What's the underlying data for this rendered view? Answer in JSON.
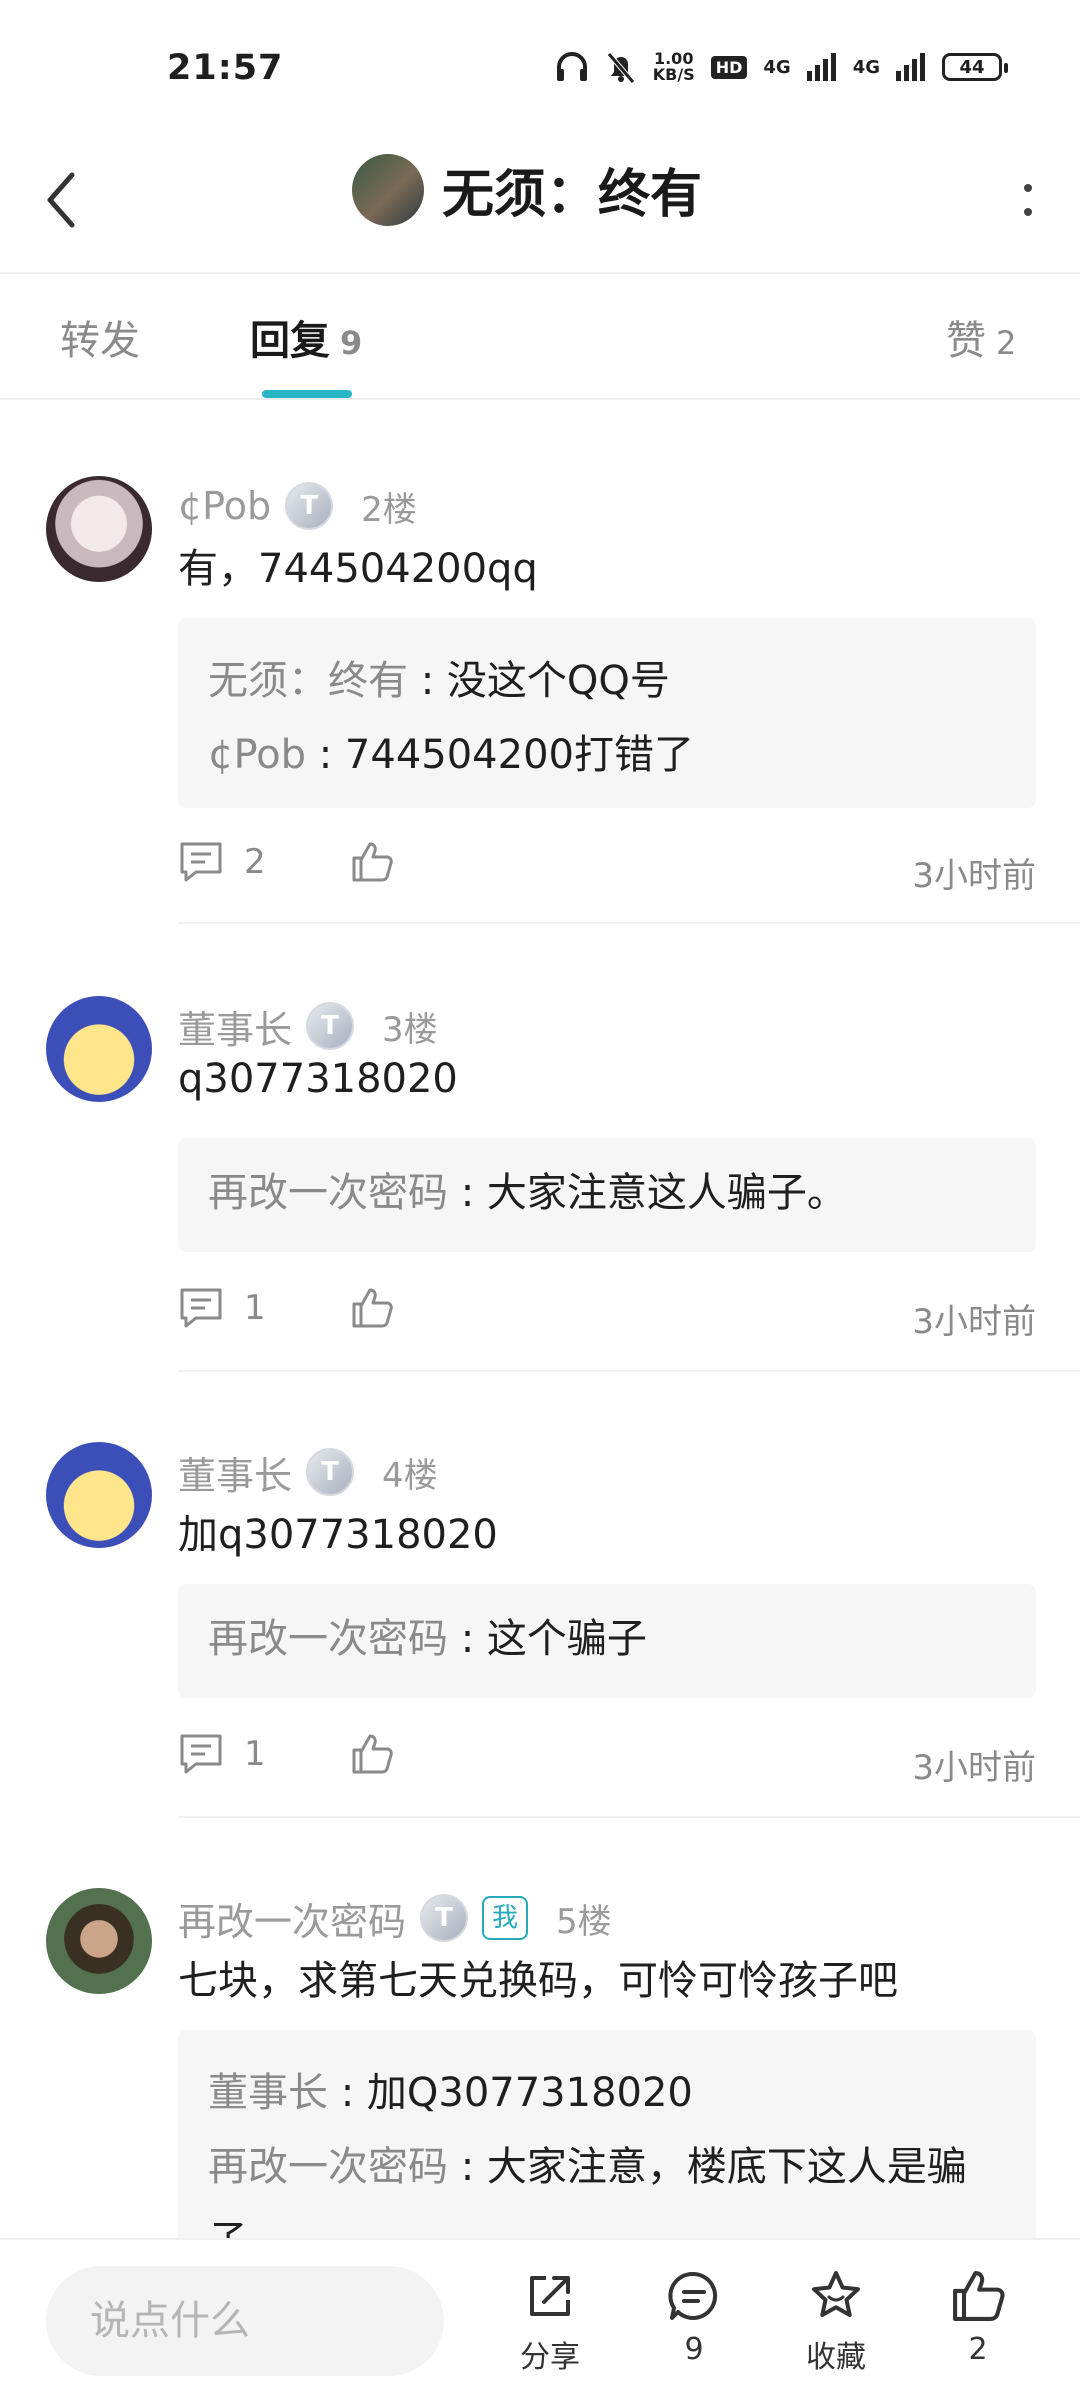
{
  "status_bar": {
    "time": "21:57",
    "speed": "1.00",
    "speed_unit": "KB/S",
    "hd": "HD",
    "net1": "4G",
    "net2": "4G",
    "battery": "44"
  },
  "header": {
    "title": "无须：终有"
  },
  "tabs": [
    {
      "label": "转发",
      "count": ""
    },
    {
      "label": "回复",
      "count": "9"
    },
    {
      "label": "赞",
      "count": "2"
    }
  ],
  "posts": [
    {
      "username": "¢Pob",
      "badge": "T",
      "floor": "2楼",
      "content": "有，744504200qq",
      "replies": [
        {
          "name": "无须：终有",
          "sep": " : ",
          "text": "没这个QQ号"
        },
        {
          "name": "¢Pob",
          "sep": " : ",
          "text": "744504200打错了"
        }
      ],
      "comment_count": "2",
      "time": "3小时前"
    },
    {
      "username": "董事长",
      "badge": "T",
      "floor": "3楼",
      "content": "q3077318020",
      "replies": [
        {
          "name": "再改一次密码",
          "sep": " : ",
          "text": "大家注意这人骗子。"
        }
      ],
      "comment_count": "1",
      "time": "3小时前"
    },
    {
      "username": "董事长",
      "badge": "T",
      "floor": "4楼",
      "content": "加q3077318020",
      "replies": [
        {
          "name": "再改一次密码",
          "sep": " : ",
          "text": "这个骗子"
        }
      ],
      "comment_count": "1",
      "time": "3小时前"
    },
    {
      "username": "再改一次密码",
      "badge": "T",
      "me_tag": "我",
      "floor": "5楼",
      "content": "七块，求第七天兑换码，可怜可怜孩子吧",
      "replies": [
        {
          "name": "董事长",
          "sep": " : ",
          "text": "加Q3077318020"
        },
        {
          "name": "再改一次密码",
          "sep": " : ",
          "text": "大家注意，楼底下这人是骗"
        },
        {
          "name": "子。",
          "sep": "",
          "text": ""
        }
      ]
    }
  ],
  "bottom_bar": {
    "input_placeholder": "说点什么",
    "share_label": "分享",
    "comment_count": "9",
    "favorite_label": "收藏",
    "like_count": "2"
  }
}
